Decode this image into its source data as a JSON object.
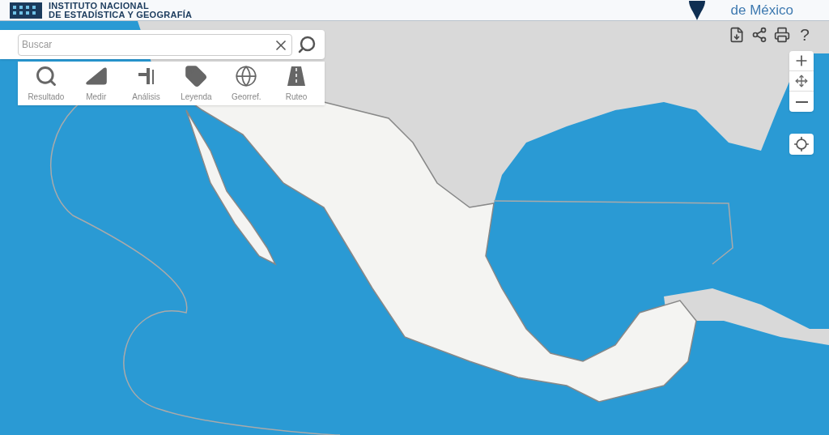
{
  "header": {
    "org_line_1": "INSTITUTO NACIONAL",
    "org_line_2": "DE ESTADÍSTICA Y GEOGRAFÍA",
    "product": "de México"
  },
  "search": {
    "placeholder": "Buscar"
  },
  "tools": [
    {
      "kind": "search",
      "label": "Resultado"
    },
    {
      "kind": "measure",
      "label": "Medir"
    },
    {
      "kind": "analysis",
      "label": "Análisis"
    },
    {
      "kind": "legend",
      "label": "Leyenda"
    },
    {
      "kind": "georef",
      "label": "Georref."
    },
    {
      "kind": "route",
      "label": "Ruteo"
    }
  ],
  "top_actions": {
    "help": "?"
  }
}
